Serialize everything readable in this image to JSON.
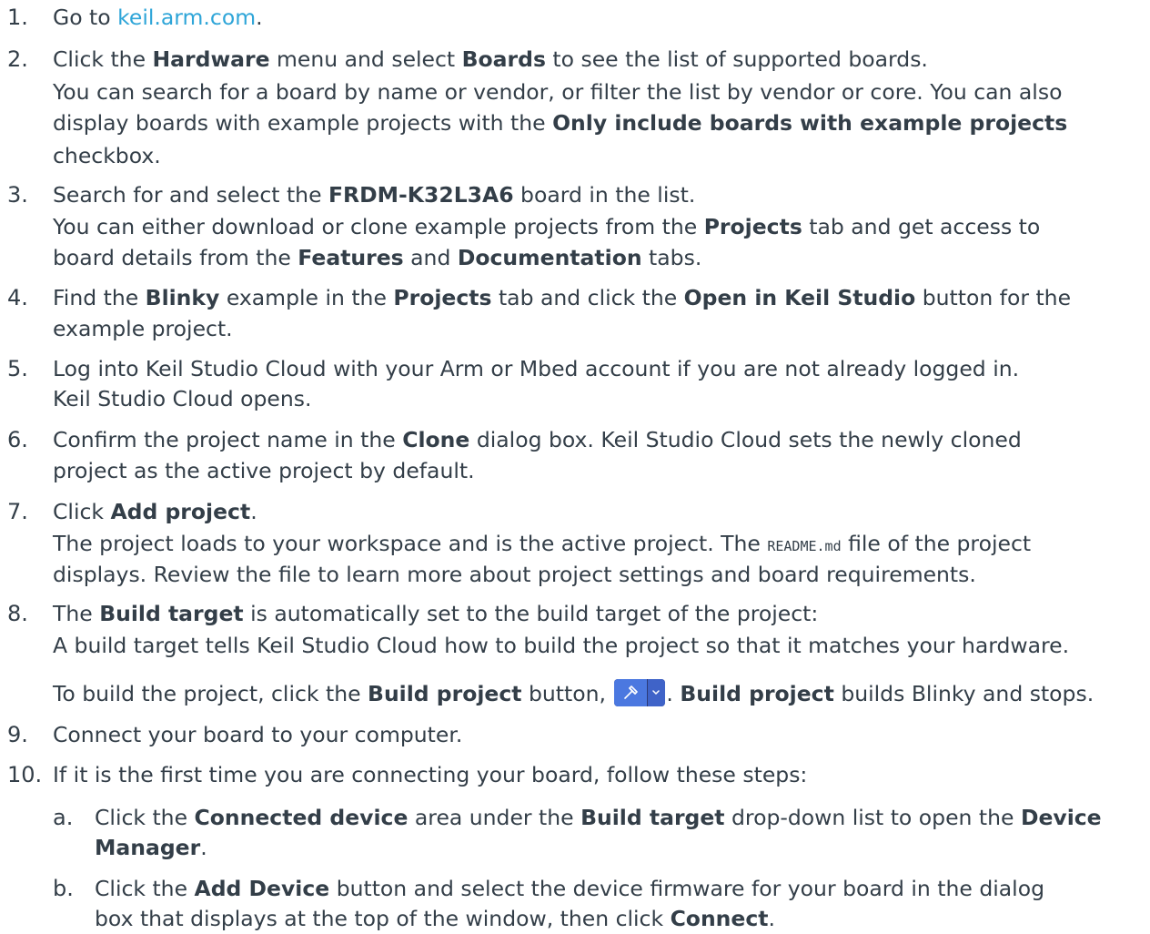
{
  "steps": [
    {
      "num": "1.",
      "lines": [
        {
          "pre": "Go to ",
          "link": "keil.arm.com",
          "post": "."
        }
      ]
    },
    {
      "num": "2.",
      "l1": {
        "t1": "Click the ",
        "b1": "Hardware",
        "t2": " menu and select ",
        "b2": "Boards",
        "t3": " to see the list of supported boards."
      },
      "l2": "You can search for a board by name or vendor, or filter the list by vendor or core. You can also",
      "l3": {
        "t1": "display boards with example projects with the ",
        "b1": "Only include boards with example projects"
      },
      "l4": "checkbox."
    },
    {
      "num": "3.",
      "l1": {
        "t1": "Search for and select the ",
        "b1": "FRDM-K32L3A6",
        "t2": " board in the list."
      },
      "l2": {
        "t1": "You can either download or clone example projects from the ",
        "b1": "Projects",
        "t2": " tab and get access to"
      },
      "l3": {
        "t1": "board details from the ",
        "b1": "Features",
        "t2": " and ",
        "b2": "Documentation",
        "t3": " tabs."
      }
    },
    {
      "num": "4.",
      "l1": {
        "t1": "Find the ",
        "b1": "Blinky",
        "t2": " example in the ",
        "b2": "Projects",
        "t3": " tab and click the ",
        "b3": "Open in Keil Studio",
        "t4": " button for the"
      },
      "l2": "example project."
    },
    {
      "num": "5.",
      "l1": "Log into Keil Studio Cloud with your Arm or Mbed account if you are not already logged in.",
      "l2": "Keil Studio Cloud opens."
    },
    {
      "num": "6.",
      "l1": {
        "t1": "Confirm the project name in the ",
        "b1": "Clone",
        "t2": " dialog box. Keil Studio Cloud sets the newly cloned"
      },
      "l2": "project as the active project by default."
    },
    {
      "num": "7.",
      "l1": {
        "t1": "Click ",
        "b1": "Add project",
        "t2": "."
      },
      "l2": {
        "t1": "The project loads to your workspace and is the active project. The ",
        "code": "README.md",
        "t2": " file of the project"
      },
      "l3": "displays. Review the file to learn more about project settings and board requirements."
    },
    {
      "num": "8.",
      "l1": {
        "t1": "The ",
        "b1": "Build target",
        "t2": " is automatically set to the build target of the project:"
      },
      "l2": "A build target tells Keil Studio Cloud how to build the project so that it matches your hardware.",
      "l3": {
        "t1": "To build the project, click the ",
        "b1": "Build project",
        "t2": " button, ",
        "t3": ". ",
        "b2": "Build project",
        "t4": " builds Blinky and stops."
      }
    },
    {
      "num": "9.",
      "l1": "Connect your board to your computer."
    },
    {
      "num": "10.",
      "l1": "If it is the first time you are connecting your board, follow these steps:"
    }
  ],
  "substeps": [
    {
      "num": "a.",
      "l1": {
        "t1": "Click the ",
        "b1": "Connected device",
        "t2": " area under the ",
        "b2": "Build target",
        "t3": " drop-down list to open the ",
        "b3": "Device"
      },
      "l2": {
        "b1": "Manager",
        "t1": "."
      }
    },
    {
      "num": "b.",
      "l1": {
        "t1": "Click the ",
        "b1": "Add Device",
        "t2": " button and select the device firmware for your board in the dialog"
      },
      "l2": {
        "t1": "box that displays at the top of the window, then click ",
        "b1": "Connect",
        "t2": "."
      }
    }
  ],
  "icons": {
    "build_button": "hammer-icon",
    "dropdown": "chevron-down-icon"
  },
  "colors": {
    "text": "#333e48",
    "link": "#2ea5d8",
    "button_main": "#4b78e0",
    "button_dark": "#2d3a78"
  }
}
